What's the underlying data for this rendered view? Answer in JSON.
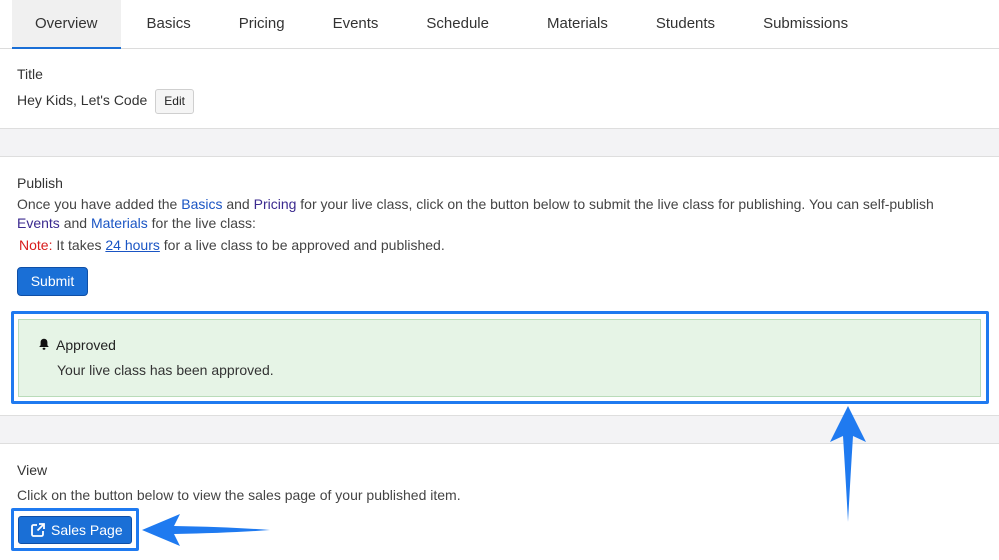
{
  "tabs": [
    {
      "label": "Overview"
    },
    {
      "label": "Basics"
    },
    {
      "label": "Pricing"
    },
    {
      "label": "Events"
    },
    {
      "label": "Schedule"
    },
    {
      "label": "Materials"
    },
    {
      "label": "Students"
    },
    {
      "label": "Submissions"
    }
  ],
  "title_section": {
    "heading": "Title",
    "value": "Hey Kids, Let's Code",
    "edit_label": "Edit"
  },
  "publish_section": {
    "heading": "Publish",
    "text_1": "Once you have added the ",
    "basics_link": "Basics",
    "text_and_1": " and ",
    "pricing_link": "Pricing",
    "text_2": " for your live class, click on the button below to submit the live class for publishing. You can self-publish",
    "events_link": "Events",
    "text_and_2": " and ",
    "materials_link": "Materials",
    "text_3": " for the live class:",
    "note_label": "Note:",
    "note_text_1": " It takes ",
    "note_link": "24 hours",
    "note_text_2": " for a live class to be approved and published.",
    "submit_label": "Submit"
  },
  "alert": {
    "icon": "bell-icon",
    "title": "Approved",
    "message": "Your live class has been approved."
  },
  "view_section": {
    "heading": "View",
    "text": "Click on the button below to view the sales page of your published item.",
    "button_label": "Sales Page",
    "button_icon": "external-link-icon"
  },
  "colors": {
    "accent": "#1a6fd6",
    "annotation": "#1f7af0",
    "alert_bg": "#e6f4e6",
    "note": "#d81b1b"
  }
}
